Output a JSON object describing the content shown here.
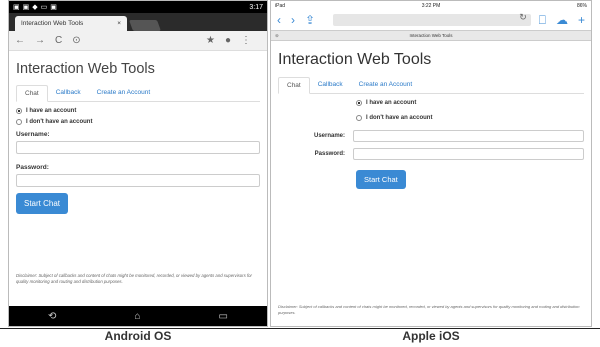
{
  "captions": {
    "android": "Android OS",
    "ios": "Apple iOS"
  },
  "android": {
    "status_time": "3:17",
    "tab_title": "Interaction Web Tools",
    "page": {
      "title": "Interaction Web Tools",
      "tabs": [
        "Chat",
        "Callback",
        "Create an Account"
      ],
      "radio_have": "I have an account",
      "radio_donthave": "I don't have an account",
      "username_label": "Username:",
      "password_label": "Password:",
      "start_button": "Start Chat",
      "disclaimer": "Disclaimer: Subject of callbacks and content of chats might be monitored, recorded, or viewed by agents and supervisors for quality monitoring and routing and distribution purposes."
    }
  },
  "ios": {
    "status_left": "iPad",
    "status_time": "3:22 PM",
    "status_battery": "86%",
    "tab_title": "Interaction Web Tools",
    "page": {
      "title": "Interaction Web Tools",
      "tabs": [
        "Chat",
        "Callback",
        "Create an Account"
      ],
      "radio_have": "I have an account",
      "radio_donthave": "I don't have an account",
      "username_label": "Username:",
      "password_label": "Password:",
      "start_button": "Start Chat",
      "disclaimer": "Disclaimer: Subject of callbacks and content of chats might be monitored, recorded, or viewed by agents and supervisors for quality monitoring and routing and distribution purposes."
    }
  }
}
